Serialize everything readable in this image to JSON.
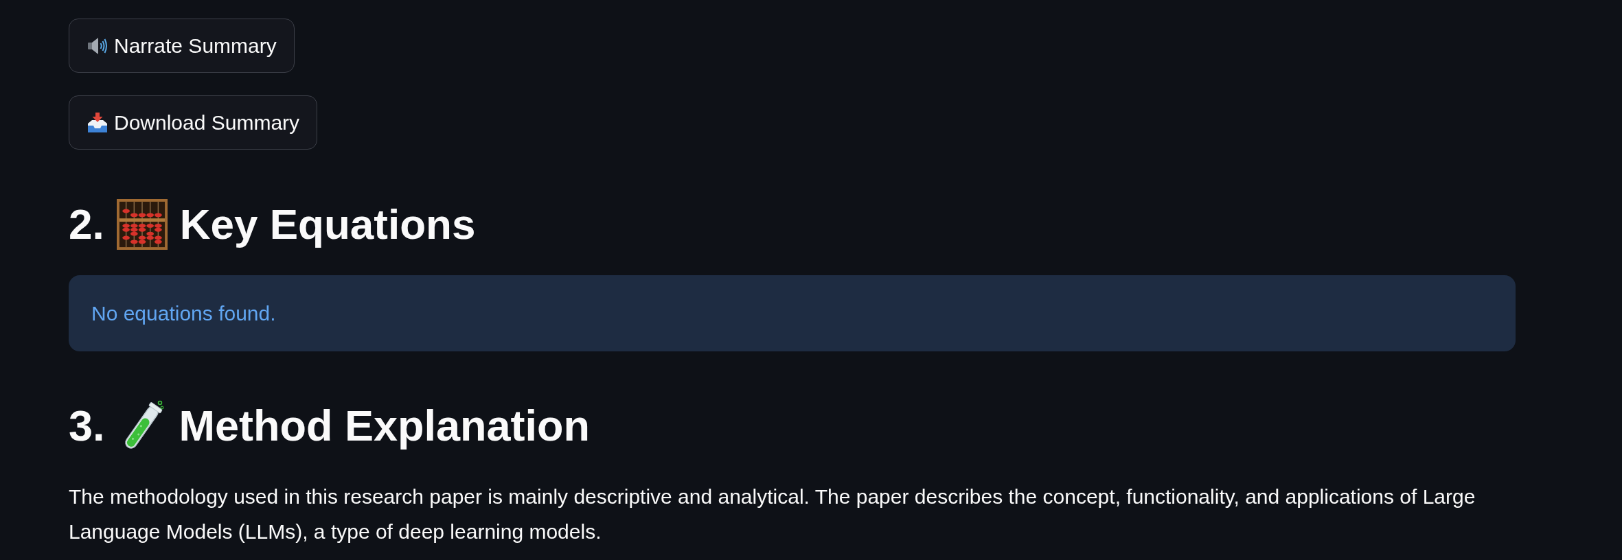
{
  "buttons": [
    {
      "kind": "narrate",
      "label": "Narrate Summary"
    },
    {
      "kind": "download",
      "label": "Download Summary"
    }
  ],
  "sections": [
    {
      "kind": "equations",
      "number": "2.",
      "title": "Key Equations",
      "info": "No equations found."
    },
    {
      "kind": "method",
      "number": "3.",
      "title": "Method Explanation",
      "paragraph": "The methodology used in this research paper is mainly descriptive and analytical. The paper describes the concept, functionality, and applications of Large Language Models (LLMs), a type of deep learning models."
    }
  ]
}
